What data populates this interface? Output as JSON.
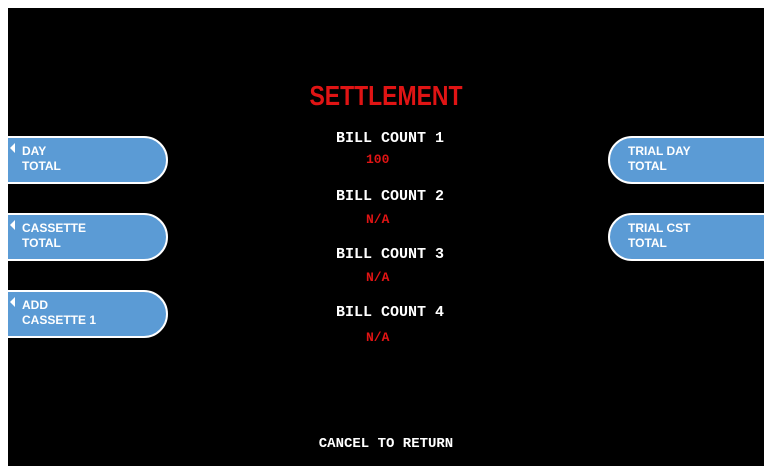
{
  "screen": {
    "title": "SETTLEMENT",
    "footer": "CANCEL TO RETURN"
  },
  "counts": [
    {
      "label": "BILL COUNT 1",
      "value": "100"
    },
    {
      "label": "BILL COUNT 2",
      "value": "N/A"
    },
    {
      "label": "BILL COUNT 3",
      "value": "N/A"
    },
    {
      "label": "BILL COUNT 4",
      "value": "N/A"
    }
  ],
  "left_buttons": [
    {
      "line1": "DAY",
      "line2": "TOTAL"
    },
    {
      "line1": "CASSETTE",
      "line2": "TOTAL"
    },
    {
      "line1": "ADD",
      "line2": "CASSETTE 1"
    }
  ],
  "right_buttons": [
    {
      "line1": "TRIAL DAY",
      "line2": "TOTAL"
    },
    {
      "line1": "TRIAL CST",
      "line2": "TOTAL"
    }
  ],
  "colors": {
    "background": "#000000",
    "title": "#e01414",
    "value": "#e01414",
    "button": "#5b9bd5",
    "text": "#ffffff"
  }
}
